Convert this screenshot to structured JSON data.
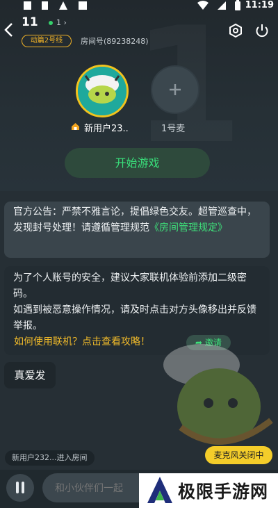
{
  "status_bar": {
    "time": "11:19"
  },
  "header": {
    "room_number": "11",
    "online_count": "1",
    "line_badge": "动篇2号线",
    "room_id": "房间号(89238248)"
  },
  "seats": [
    {
      "name": "新用户23..",
      "role": "host"
    },
    {
      "name": "1号麦",
      "role": "empty"
    }
  ],
  "start_button": "开始游戏",
  "notice": {
    "text": "官方公告：严禁不雅言论，提倡绿色交友。超管巡查中，发现封号处理！请遵循管理规范",
    "link": "《房间管理规定》"
  },
  "tips": {
    "line1": "为了个人账号的安全，建议大家联机体验前添加二级密码。",
    "line2": "如遇到被恶意操作情况，请及时点击对方头像移出并反馈举报。",
    "guide_link": "如何使用联机？点击查看攻略！",
    "invite_label": "邀请"
  },
  "chat_message": "真爱发",
  "system_message": "新用户232...进入房间",
  "mic_status": "麦克风关闭中",
  "input": {
    "placeholder": "和小伙伴们一起"
  },
  "watermark": "极限手游网",
  "colors": {
    "accent_green": "#3ee07a",
    "badge_yellow": "#f2b327",
    "mic_yellow": "#f4cd2a"
  }
}
